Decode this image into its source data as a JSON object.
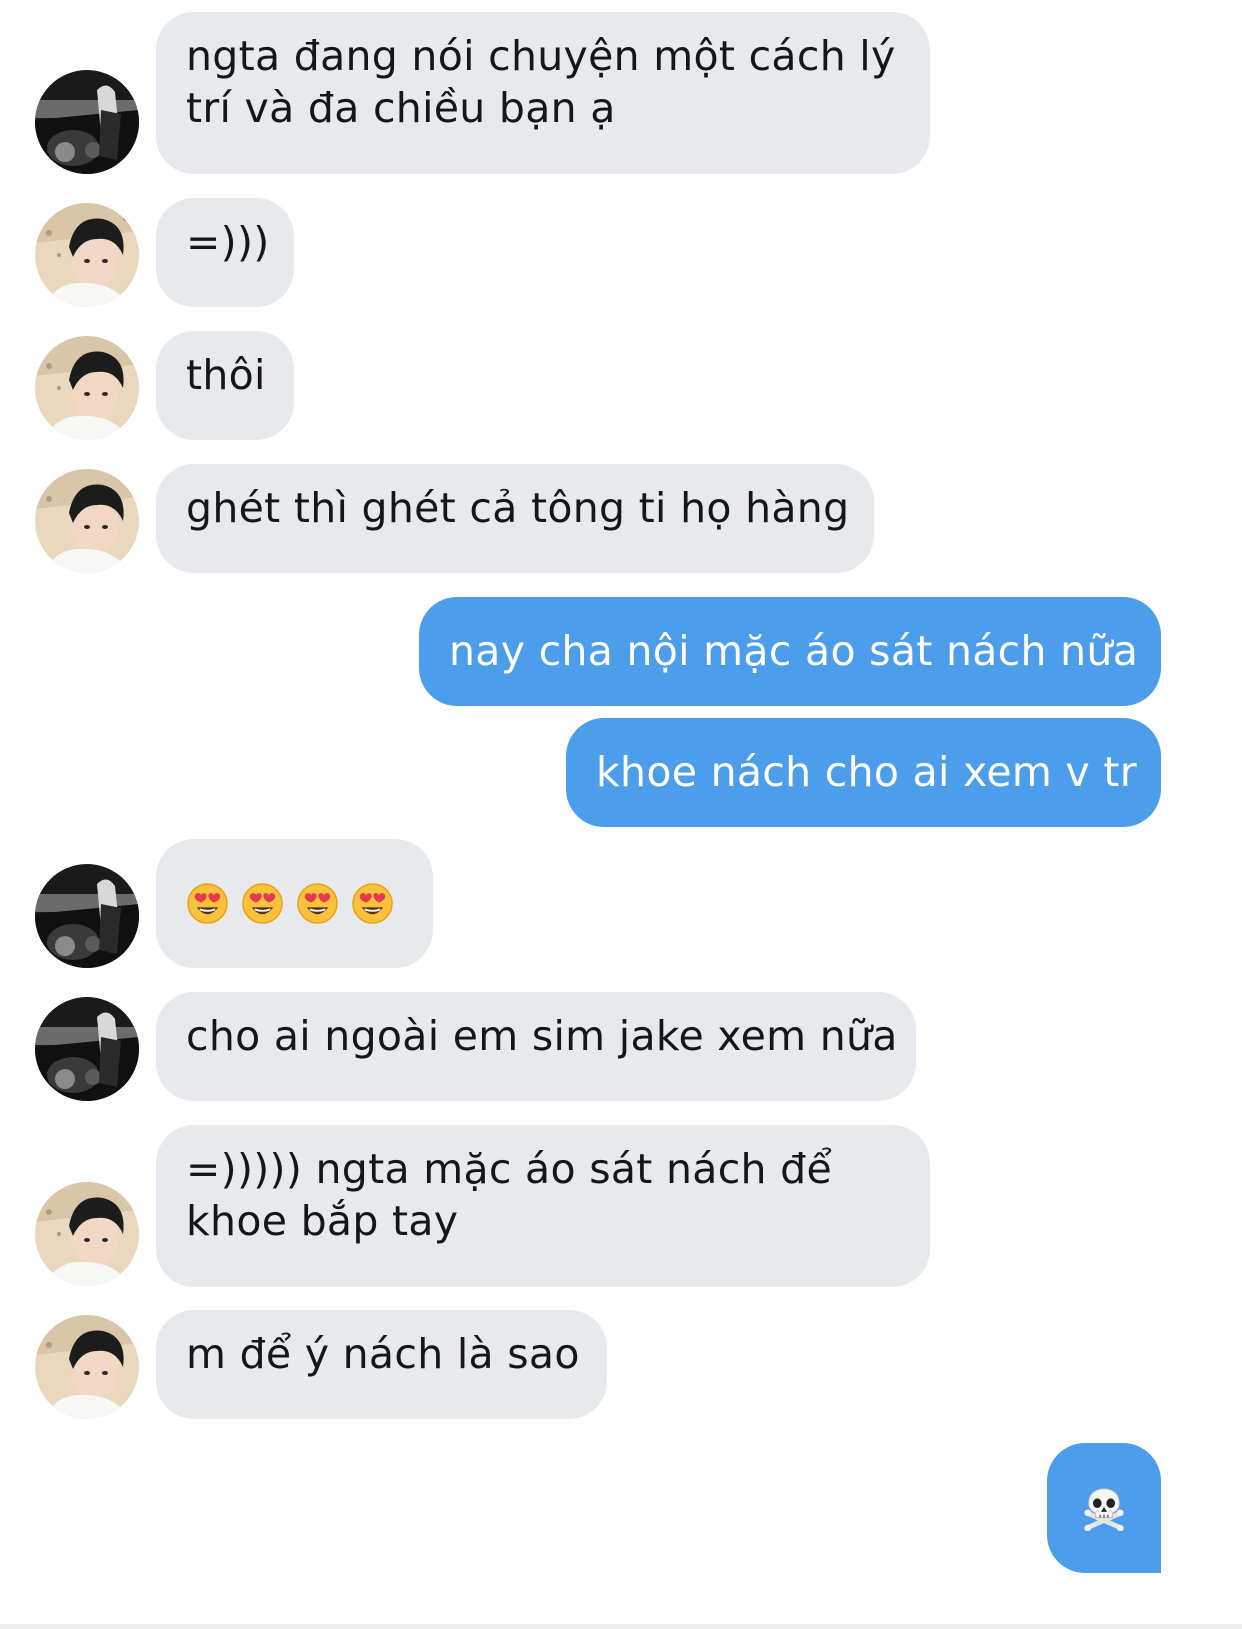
{
  "conversation": {
    "messages": [
      {
        "sender": "other-bw",
        "text": "ngta đang nói chuyện một cách lý\ntrí và đa chiều bạn ạ"
      },
      {
        "sender": "other-beach",
        "text": "=)))"
      },
      {
        "sender": "other-beach",
        "text": "thôi"
      },
      {
        "sender": "other-beach",
        "text": "ghét thì ghét cả tông ti họ hàng"
      },
      {
        "sender": "me",
        "text": "nay cha nội mặc áo sát nách nữa"
      },
      {
        "sender": "me",
        "text": "khoe nách cho ai xem v tr"
      },
      {
        "sender": "other-bw",
        "emoji": [
          "smiling-face-with-heart-eyes",
          "smiling-face-with-heart-eyes",
          "smiling-face-with-heart-eyes",
          "smiling-face-with-heart-eyes"
        ]
      },
      {
        "sender": "other-bw",
        "text": "cho ai ngoài em sim jake xem nữa"
      },
      {
        "sender": "other-beach",
        "text": "=))))) ngta mặc áo sát nách để\nkhoe bắp tay"
      },
      {
        "sender": "other-beach",
        "text": "m để ý nách là sao"
      },
      {
        "sender": "me",
        "emoji": [
          "skull-and-crossbones"
        ]
      }
    ]
  },
  "colors": {
    "incoming_bubble": "#e7e9ed",
    "outgoing_bubble": "#4c9eeb",
    "incoming_text": "#14171a",
    "outgoing_text": "#ffffff"
  }
}
